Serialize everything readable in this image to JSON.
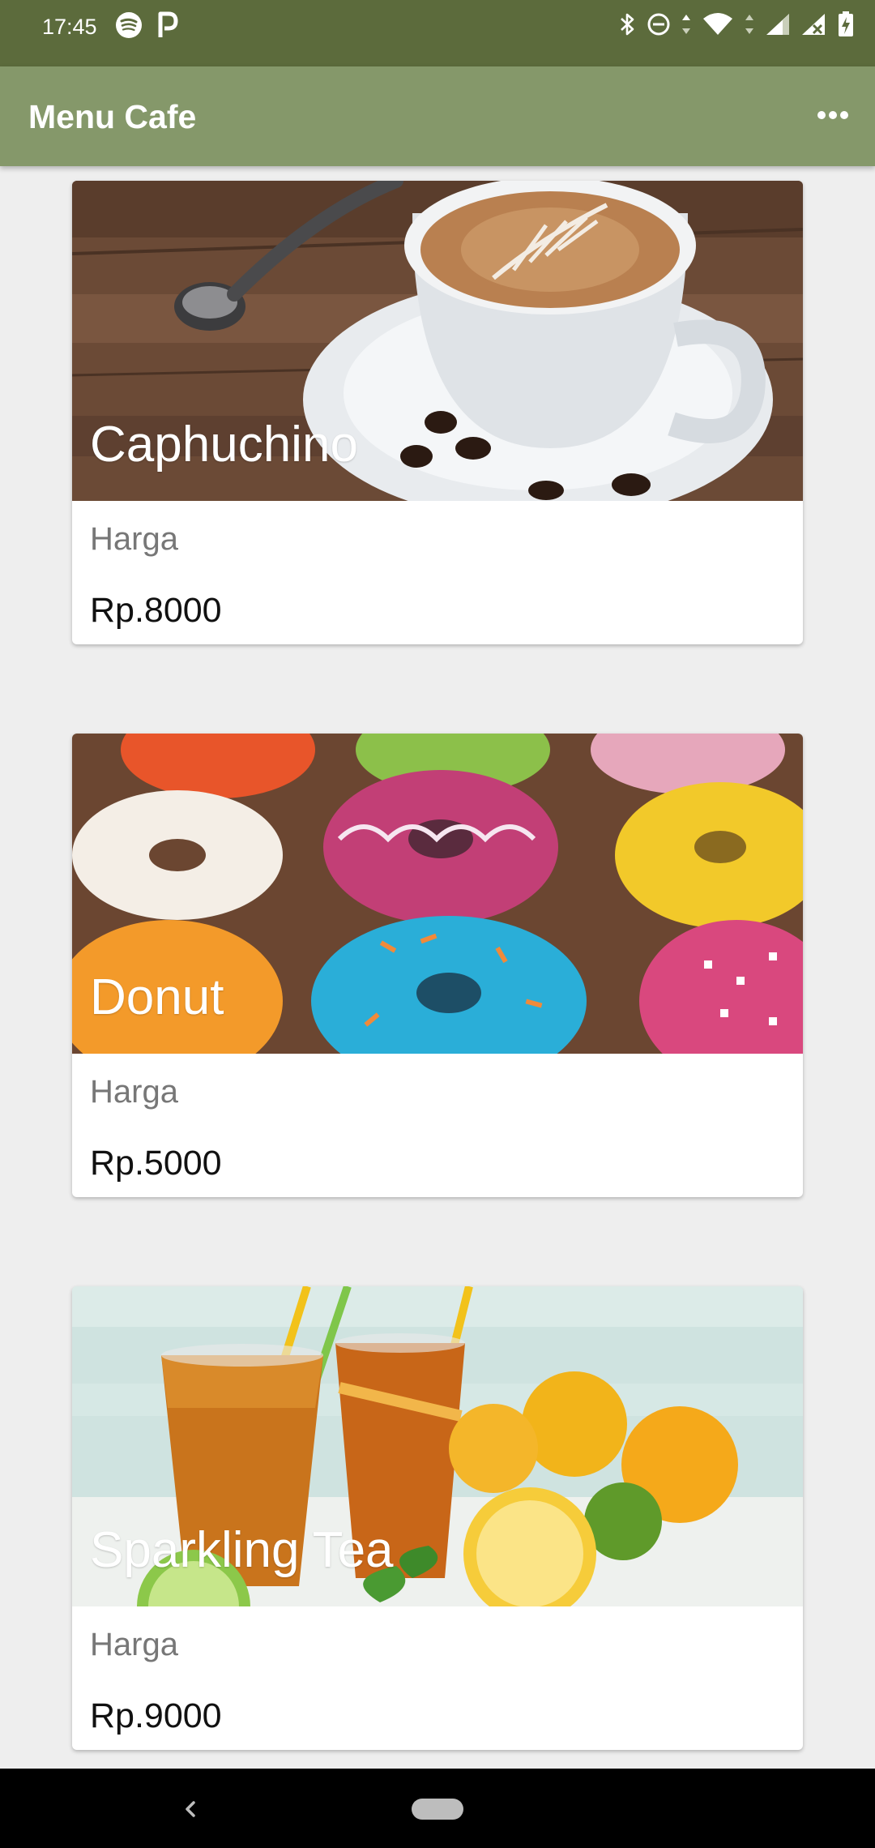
{
  "status_bar": {
    "time": "17:45",
    "icons": [
      "spotify-icon",
      "p-icon",
      "bluetooth-icon",
      "do-not-disturb-icon",
      "wifi-icon",
      "signal-icon",
      "signal-no-data-icon",
      "battery-charging-icon"
    ]
  },
  "app_bar": {
    "title": "Menu Cafe",
    "overflow_icon": "more-horiz-icon"
  },
  "menu_items": [
    {
      "name": "Caphuchino",
      "price_label": "Harga",
      "price": "Rp.8000"
    },
    {
      "name": "Donut",
      "price_label": "Harga",
      "price": "Rp.5000"
    },
    {
      "name": "Sparkling Tea",
      "price_label": "Harga",
      "price": "Rp.9000"
    }
  ],
  "colors": {
    "status_bar": "#5c6b3c",
    "app_bar": "#85986a",
    "background": "#eeeeee",
    "card": "#ffffff"
  }
}
